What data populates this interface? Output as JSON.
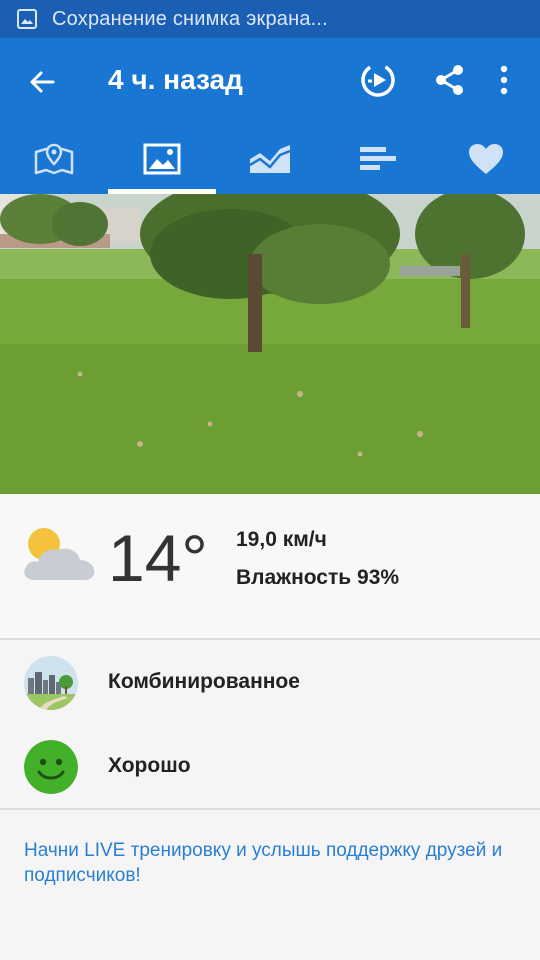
{
  "status_bar": {
    "notification_icon": "image-icon",
    "text": "Сохранение снимка экрана..."
  },
  "toolbar": {
    "back_icon": "arrow-left-icon",
    "title": "4 ч. назад",
    "actions": [
      "replay-icon",
      "share-icon",
      "more-vert-icon"
    ]
  },
  "tabs": [
    {
      "icon": "map-icon",
      "active": false
    },
    {
      "icon": "photo-icon",
      "active": true
    },
    {
      "icon": "chart-icon",
      "active": false
    },
    {
      "icon": "list-icon",
      "active": false
    },
    {
      "icon": "heart-icon",
      "active": false
    }
  ],
  "weather": {
    "icon": "partly-cloudy-icon",
    "temperature": "14°",
    "wind": "19,0 км/ч",
    "humidity": "Влажность 93%"
  },
  "surface": {
    "icon": "terrain-landscape-icon",
    "label": "Комбинированное"
  },
  "feeling": {
    "icon": "smiley-icon",
    "label": "Хорошо"
  },
  "promo_text": "Начни LIVE тренировку и услышь поддержку друзей и подписчиков!",
  "colors": {
    "status_bar": "#1a5fb4",
    "toolbar": "#1976d2",
    "accent_link": "#2a7fd4",
    "smiley_green": "#43b02a"
  }
}
